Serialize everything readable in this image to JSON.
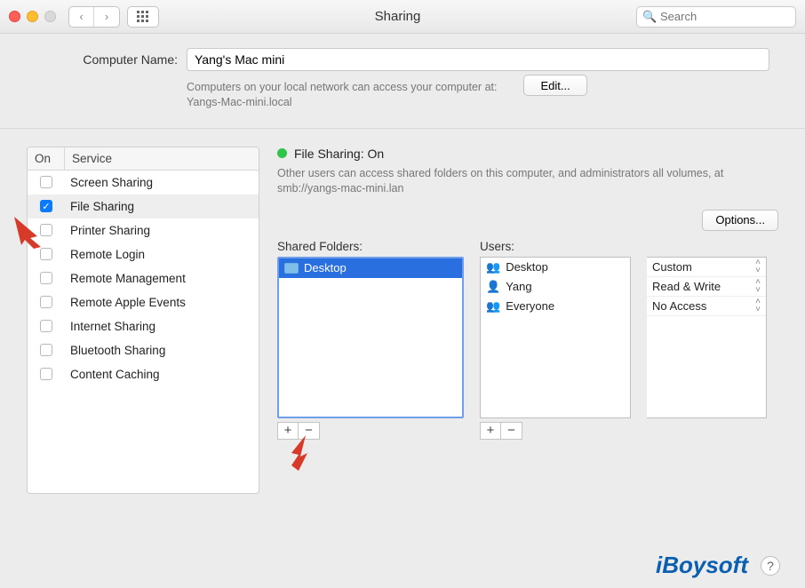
{
  "window": {
    "title": "Sharing",
    "search_placeholder": "Search"
  },
  "header": {
    "computer_name_label": "Computer Name:",
    "computer_name_value": "Yang's Mac mini",
    "hint_line1": "Computers on your local network can access your computer at:",
    "hint_line2": "Yangs-Mac-mini.local",
    "edit_label": "Edit..."
  },
  "services": {
    "col_on": "On",
    "col_service": "Service",
    "items": [
      {
        "label": "Screen Sharing",
        "on": false,
        "selected": false
      },
      {
        "label": "File Sharing",
        "on": true,
        "selected": true
      },
      {
        "label": "Printer Sharing",
        "on": false,
        "selected": false
      },
      {
        "label": "Remote Login",
        "on": false,
        "selected": false
      },
      {
        "label": "Remote Management",
        "on": false,
        "selected": false
      },
      {
        "label": "Remote Apple Events",
        "on": false,
        "selected": false
      },
      {
        "label": "Internet Sharing",
        "on": false,
        "selected": false
      },
      {
        "label": "Bluetooth Sharing",
        "on": false,
        "selected": false
      },
      {
        "label": "Content Caching",
        "on": false,
        "selected": false
      }
    ]
  },
  "detail": {
    "status_title": "File Sharing: On",
    "description": "Other users can access shared folders on this computer, and administrators all volumes, at smb://yangs-mac-mini.lan",
    "options_label": "Options...",
    "shared_folders_header": "Shared Folders:",
    "users_header": "Users:",
    "folders": [
      {
        "label": "Desktop",
        "selected": true
      }
    ],
    "users": [
      {
        "label": "Desktop",
        "icon": "group"
      },
      {
        "label": "Yang",
        "icon": "user"
      },
      {
        "label": "Everyone",
        "icon": "group"
      }
    ],
    "permissions": [
      {
        "label": "Custom"
      },
      {
        "label": "Read & Write"
      },
      {
        "label": "No Access"
      }
    ],
    "add_symbol": "+",
    "remove_symbol": "−"
  },
  "branding": {
    "text": "iBoysoft",
    "help": "?"
  }
}
